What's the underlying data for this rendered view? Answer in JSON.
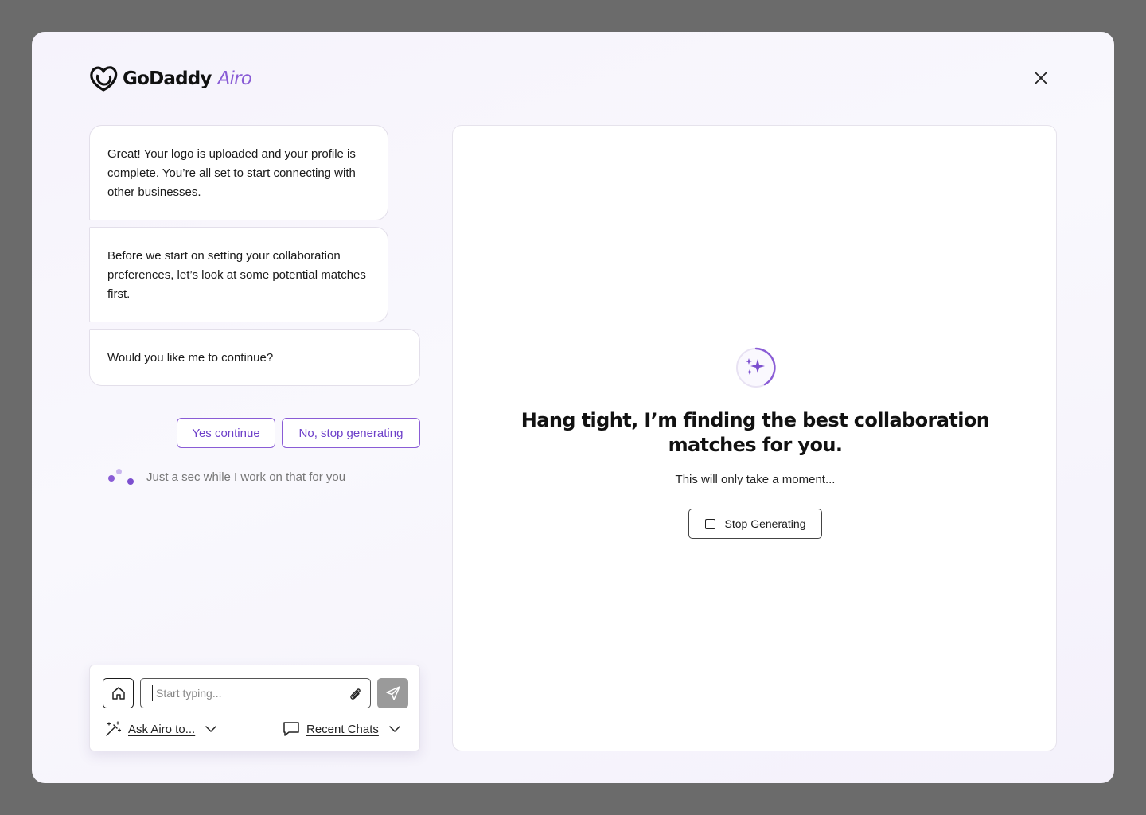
{
  "brand": {
    "logo_text": "GoDaddy",
    "logo_product": "Airo",
    "accent_color": "#8a5cd6"
  },
  "header": {
    "close_icon": "close-icon"
  },
  "chat": {
    "messages": [
      {
        "text": "Great! Your logo is uploaded and your profile is complete. You’re all set to start connecting with other businesses."
      },
      {
        "text": "Before we start on setting your collaboration preferences, let’s look at some potential matches first."
      },
      {
        "text": "Would you like me to continue?"
      }
    ],
    "choices": {
      "yes": "Yes continue",
      "no": "No, stop generating"
    },
    "status_text": "Just a sec while I work on that for you"
  },
  "composer": {
    "placeholder": "Start typing...",
    "value": "",
    "ask_label": "Ask Airo to...",
    "recent_label": "Recent Chats",
    "home_icon": "home-icon",
    "attach_icon": "paperclip-icon",
    "send_icon": "send-icon"
  },
  "panel": {
    "headline": "Hang tight, I’m finding the best collaboration matches for you.",
    "subline": "This will only take a moment...",
    "stop_button": "Stop Generating",
    "spinner_icon": "sparkle-icon"
  }
}
